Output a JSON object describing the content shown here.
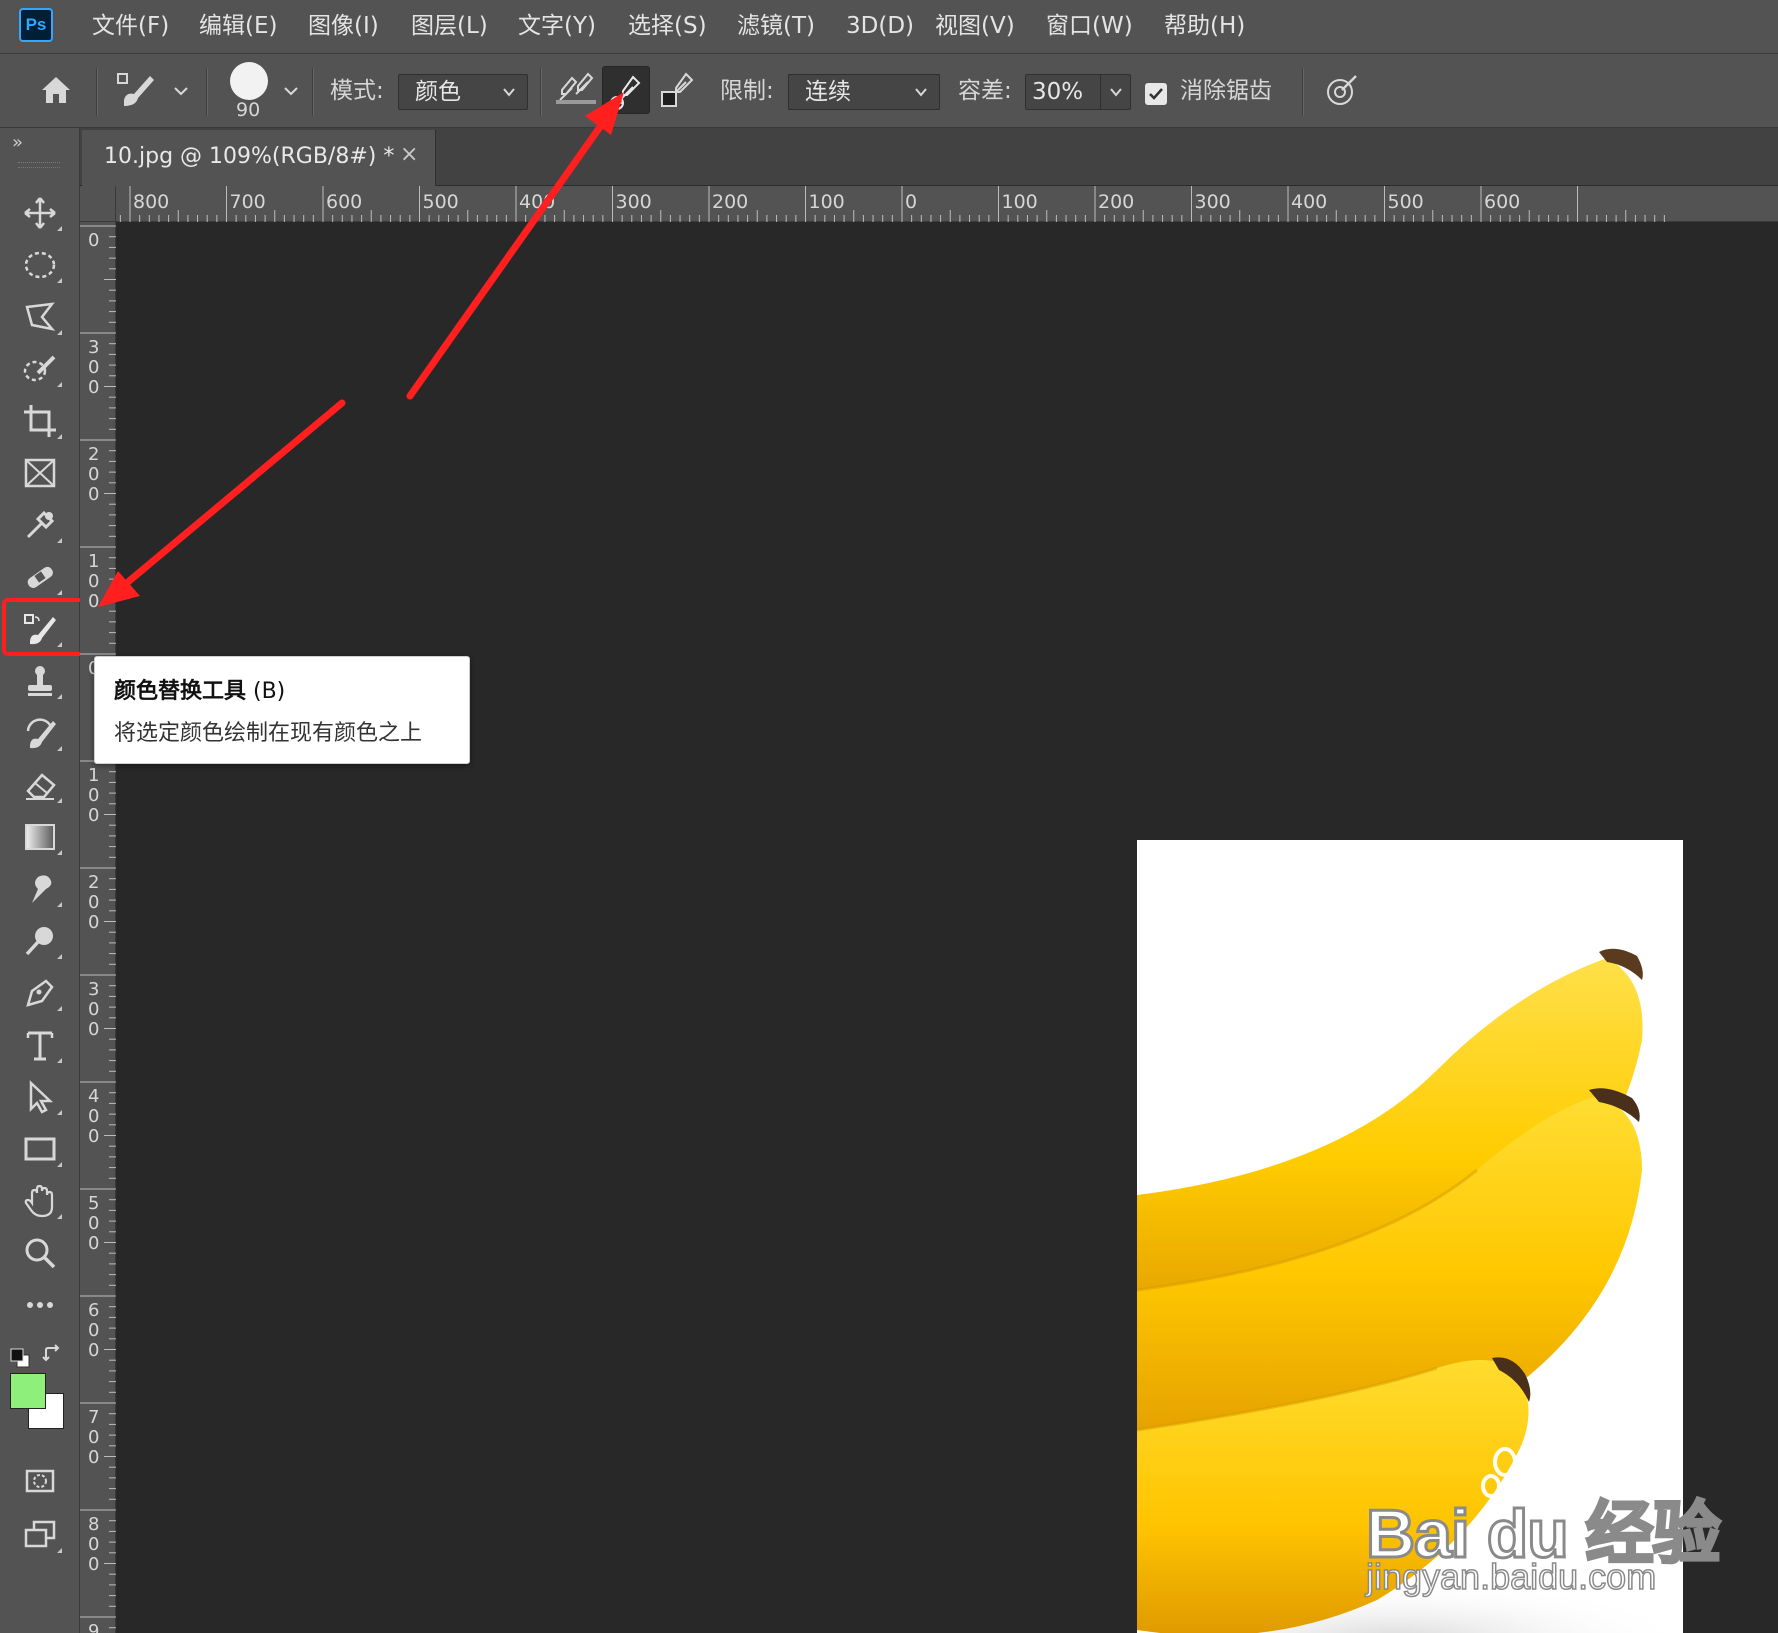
{
  "app": {
    "logo_text": "Ps",
    "menu": [
      "文件(F)",
      "编辑(E)",
      "图像(I)",
      "图层(L)",
      "文字(Y)",
      "选择(S)",
      "滤镜(T)",
      "3D(D)",
      "视图(V)",
      "窗口(W)",
      "帮助(H)"
    ]
  },
  "options": {
    "brush_size": "90",
    "mode_label": "模式:",
    "mode_value": "颜色",
    "limit_label": "限制:",
    "limit_value": "连续",
    "tolerance_label": "容差:",
    "tolerance_value": "30%",
    "antialias_label": "消除锯齿",
    "antialias_checked": true
  },
  "toolbar": {
    "collapse_glyph": "»",
    "foreground_color": "#8ef07a",
    "background_color": "#ffffff"
  },
  "document": {
    "tab_title": "10.jpg @ 109%(RGB/8#) *",
    "close_glyph": "×"
  },
  "rulers": {
    "horizontal": [
      "800",
      "700",
      "600",
      "500",
      "400",
      "300",
      "200",
      "100",
      "0",
      "100",
      "200",
      "300",
      "400",
      "500",
      "600"
    ],
    "vertical": [
      "0",
      "300",
      "200",
      "100",
      "0",
      "100",
      "200",
      "300",
      "400",
      "500",
      "600",
      "700",
      "800",
      "9"
    ]
  },
  "tooltip": {
    "title": "颜色替换工具",
    "shortcut": " (B)",
    "description": "将选定颜色绘制在现有颜色之上"
  },
  "watermark": {
    "main": "Bai du 经验",
    "url": "jingyan.baidu.com"
  },
  "colors": {
    "annotation": "#ff1f1f",
    "banana": "#ffd100"
  }
}
